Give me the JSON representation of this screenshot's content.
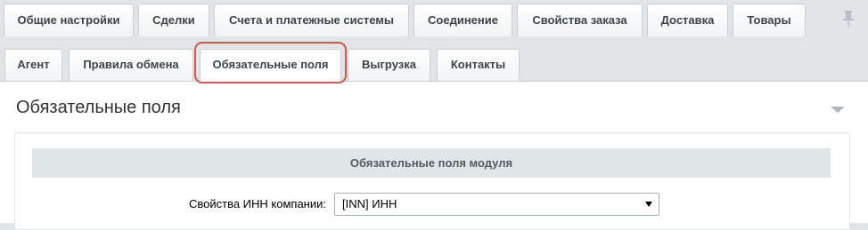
{
  "top_tabs": [
    "Общие настройки",
    "Сделки",
    "Счета и платежные системы",
    "Соединение",
    "Свойства заказа",
    "Доставка",
    "Товары"
  ],
  "sub_tabs": [
    "Агент",
    "Правила обмена",
    "Обязательные поля",
    "Выгрузка",
    "Контакты"
  ],
  "active_sub_tab": "Обязательные поля",
  "section": {
    "title": "Обязательные поля",
    "subheading": "Обязательные поля модуля",
    "field_label": "Свойства ИНН компании:",
    "field_value": "[INN] ИНН"
  },
  "icons": {
    "pin": "pin-icon",
    "collapse": "triangle-down-icon",
    "select_arrow": "dropdown-arrow-icon"
  },
  "colors": {
    "highlight": "#d2584b",
    "tab_border": "#c9cfd3",
    "subheading_bg": "#e0e6e7"
  }
}
